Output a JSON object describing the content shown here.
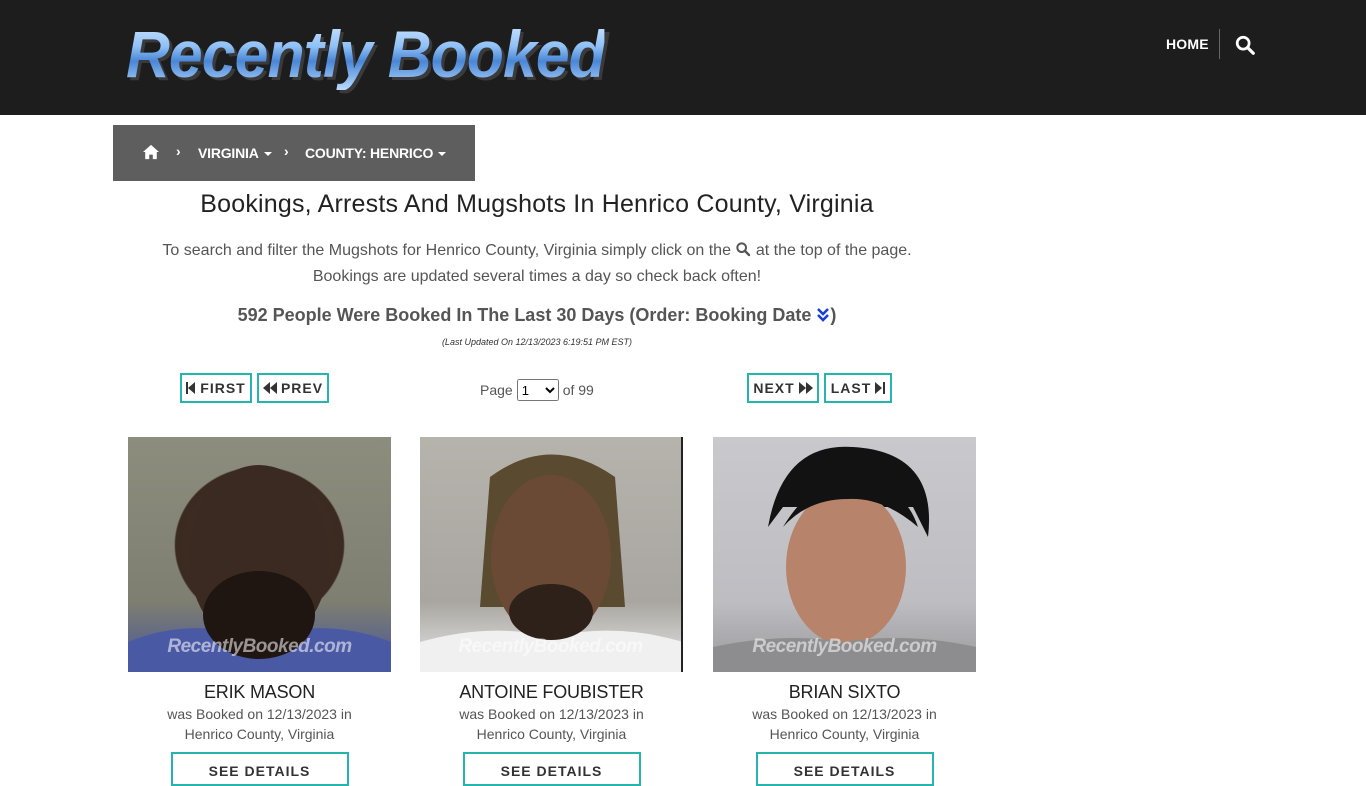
{
  "header": {
    "logo_text": "Recently Booked",
    "nav_home": "HOME"
  },
  "breadcrumb": {
    "state": "VIRGINIA",
    "county": "COUNTY: HENRICO"
  },
  "page": {
    "title": "Bookings, Arrests And Mugshots In Henrico County, Virginia",
    "intro_part1": "To search and filter the Mugshots for Henrico County, Virginia simply click on the",
    "intro_part2": "at the top of the page.",
    "intro_line2": "Bookings are updated several times a day so check back often!",
    "count_text": "592 People Were Booked In The Last 30 Days (Order: Booking Date",
    "count_close": ")",
    "last_updated": "(Last Updated On 12/13/2023 6:19:51 PM EST)"
  },
  "pagination": {
    "first": "FIRST",
    "prev": "PREV",
    "next": "NEXT",
    "last": "LAST",
    "page_label": "Page",
    "current_page": "1",
    "of_label": "of 99"
  },
  "bookings": [
    {
      "name": "ERIK MASON",
      "booked_line1": "was Booked on 12/13/2023 in",
      "booked_line2": "Henrico County, Virginia",
      "watermark": "RecentlyBooked.com",
      "details_label": "SEE DETAILS"
    },
    {
      "name": "ANTOINE FOUBISTER",
      "booked_line1": "was Booked on 12/13/2023 in",
      "booked_line2": "Henrico County, Virginia",
      "watermark": "RecentlyBooked.com",
      "details_label": "SEE DETAILS"
    },
    {
      "name": "BRIAN SIXTO",
      "booked_line1": "was Booked on 12/13/2023 in",
      "booked_line2": "Henrico County, Virginia",
      "watermark": "RecentlyBooked.com",
      "details_label": "SEE DETAILS"
    }
  ],
  "colors": {
    "header_bg": "#1d1d1d",
    "breadcrumb_bg": "#5e5e5e",
    "accent_border": "#26b5ad",
    "order_icon": "#1a3fd1"
  },
  "icons": {
    "search": "search-icon",
    "home": "home-icon",
    "order": "chevron-double-down-icon"
  }
}
